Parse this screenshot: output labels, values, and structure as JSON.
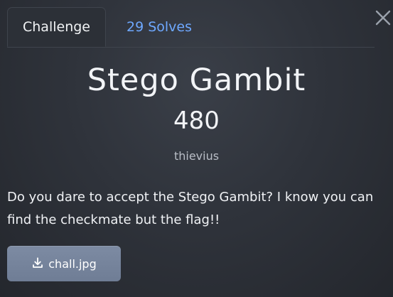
{
  "tabs": {
    "challenge": "Challenge",
    "solves": "29 Solves"
  },
  "challenge": {
    "title": "Stego Gambit",
    "points": "480",
    "author": "thievius",
    "description": "Do you dare to accept the Stego Gambit? I know you can find the checkmate but the flag!!"
  },
  "attachments": [
    {
      "filename": "chall.jpg"
    }
  ],
  "icons": {
    "close": "close-icon",
    "download": "download-icon"
  },
  "colors": {
    "background": "#2f333b",
    "active_tab_text": "#f1f3f5",
    "tab_link": "#6ea8ff",
    "button": "#7685a0"
  }
}
